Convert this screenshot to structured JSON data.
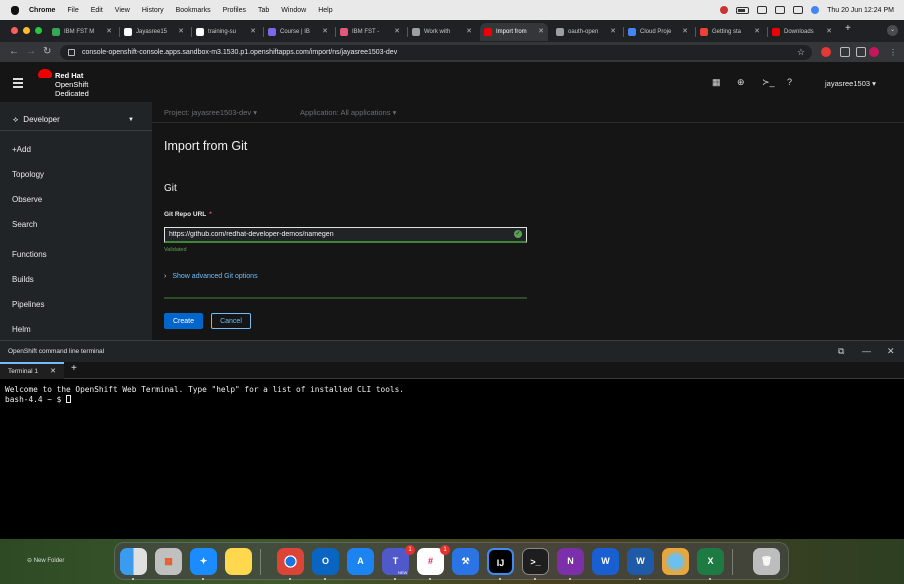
{
  "menubar": {
    "app": "Chrome",
    "items": [
      "File",
      "Edit",
      "View",
      "History",
      "Bookmarks",
      "Profiles",
      "Tab",
      "Window",
      "Help"
    ],
    "clock": "Thu 20 Jun  12:24 PM"
  },
  "tabs": [
    {
      "label": "IBM FST M",
      "color": "#34a853"
    },
    {
      "label": "Jayasree15",
      "color": "#ffffff"
    },
    {
      "label": "training-su",
      "color": "#ffffff"
    },
    {
      "label": "Course | IB",
      "color": "#7b68ee"
    },
    {
      "label": "IBM FST -",
      "color": "#e25a7a"
    },
    {
      "label": "Work with",
      "color": "#9aa0a6"
    },
    {
      "label": "Import from",
      "color": "#ee0000",
      "active": true
    },
    {
      "label": "oauth-open",
      "color": "#9aa0a6"
    },
    {
      "label": "Cloud Proje",
      "color": "#4285f4"
    },
    {
      "label": "Getting sta",
      "color": "#ea4335"
    },
    {
      "label": "Downloads",
      "color": "#ee0000"
    }
  ],
  "address": {
    "url": "console-openshift-console.apps.sandbox-m3.1530.p1.openshiftapps.com/import/ns/jayasree1503-dev"
  },
  "masthead": {
    "brand_line1": "Red Hat",
    "brand_line2": "OpenShift",
    "brand_line3": "Dedicated",
    "user": "jayasree1503 ▾"
  },
  "sidebar": {
    "perspective": "Developer",
    "items": [
      "+Add",
      "Topology",
      "Observe",
      "Search",
      "Functions",
      "Builds",
      "Pipelines",
      "Helm"
    ]
  },
  "context": {
    "project": "Project: jayasree1503-dev",
    "application": "Application: All applications"
  },
  "form": {
    "title": "Import from Git",
    "section": "Git",
    "repo_label": "Git Repo URL",
    "required": "*",
    "repo_value": "https://github.com/redhat-developer-demos/namegen",
    "helper": "Validated",
    "advanced": "Show advanced Git options",
    "create": "Create",
    "cancel": "Cancel"
  },
  "terminal": {
    "title": "OpenShift command line terminal",
    "tab": "Terminal 1",
    "line1": "Welcome to the OpenShift Web Terminal. Type \"help\" for a list of installed CLI tools.",
    "prompt": "bash-4.4 ~ $ "
  },
  "desktop": {
    "new_folder": "New Folder"
  },
  "dock": {
    "badges": {
      "teams": "1",
      "slack": "1",
      "new": "NEW"
    },
    "apps": [
      "finder",
      "launchpad",
      "safari",
      "notes",
      "chrome",
      "outlook",
      "app-store",
      "teams",
      "slack",
      "xcode",
      "intellij",
      "terminal",
      "onenote",
      "webex",
      "word",
      "preview",
      "excel",
      "trash"
    ]
  }
}
